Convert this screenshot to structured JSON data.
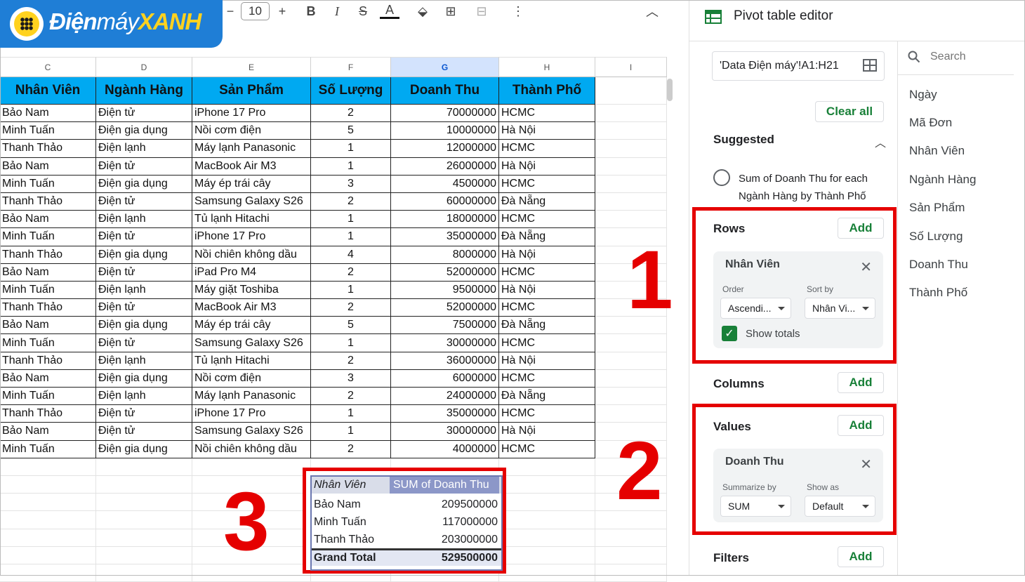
{
  "logo": {
    "text_a": "Điện",
    "text_b": "máy",
    "text_c": "XANH"
  },
  "toolbar": {
    "minus": "−",
    "font_size": "10",
    "plus": "+",
    "bold": "B",
    "italic": "I",
    "strike": "S",
    "textcolor": "A",
    "fill": "⬙",
    "borders": "⊞",
    "merge": "⊟",
    "more": "⋮",
    "collapse": "︿"
  },
  "columns": [
    "C",
    "D",
    "E",
    "F",
    "G",
    "H",
    "I"
  ],
  "table": {
    "headers": [
      "Nhân Viên",
      "Ngành Hàng",
      "Sản Phẩm",
      "Số Lượng",
      "Doanh Thu",
      "Thành Phố"
    ],
    "rows": [
      [
        "Bảo Nam",
        "Điện tử",
        "iPhone 17 Pro",
        "2",
        "70000000",
        "HCMC"
      ],
      [
        "Minh Tuấn",
        "Điện gia dụng",
        "Nồi cơm điện",
        "5",
        "10000000",
        "Hà Nội"
      ],
      [
        "Thanh Thảo",
        "Điện lạnh",
        "Máy lạnh Panasonic",
        "1",
        "12000000",
        "HCMC"
      ],
      [
        "Bảo Nam",
        "Điện tử",
        "MacBook Air M3",
        "1",
        "26000000",
        "Hà Nội"
      ],
      [
        "Minh Tuấn",
        "Điện gia dụng",
        "Máy ép trái cây",
        "3",
        "4500000",
        "HCMC"
      ],
      [
        "Thanh Thảo",
        "Điện tử",
        "Samsung Galaxy S26",
        "2",
        "60000000",
        "Đà Nẵng"
      ],
      [
        "Bảo Nam",
        "Điện lạnh",
        "Tủ lạnh Hitachi",
        "1",
        "18000000",
        "HCMC"
      ],
      [
        "Minh Tuấn",
        "Điện tử",
        "iPhone 17 Pro",
        "1",
        "35000000",
        "Đà Nẵng"
      ],
      [
        "Thanh Thảo",
        "Điện gia dụng",
        "Nồi chiên không dầu",
        "4",
        "8000000",
        "Hà Nội"
      ],
      [
        "Bảo Nam",
        "Điện tử",
        "iPad Pro M4",
        "2",
        "52000000",
        "HCMC"
      ],
      [
        "Minh Tuấn",
        "Điện lạnh",
        "Máy giặt Toshiba",
        "1",
        "9500000",
        "Hà Nội"
      ],
      [
        "Thanh Thảo",
        "Điện tử",
        "MacBook Air M3",
        "2",
        "52000000",
        "HCMC"
      ],
      [
        "Bảo Nam",
        "Điện gia dụng",
        "Máy ép trái cây",
        "5",
        "7500000",
        "Đà Nẵng"
      ],
      [
        "Minh Tuấn",
        "Điện tử",
        "Samsung Galaxy S26",
        "1",
        "30000000",
        "HCMC"
      ],
      [
        "Thanh Thảo",
        "Điện lạnh",
        "Tủ lạnh Hitachi",
        "2",
        "36000000",
        "Hà Nội"
      ],
      [
        "Bảo Nam",
        "Điện gia dụng",
        "Nồi cơm điện",
        "3",
        "6000000",
        "HCMC"
      ],
      [
        "Minh Tuấn",
        "Điện lạnh",
        "Máy lạnh Panasonic",
        "2",
        "24000000",
        "Đà Nẵng"
      ],
      [
        "Thanh Thảo",
        "Điện tử",
        "iPhone 17 Pro",
        "1",
        "35000000",
        "HCMC"
      ],
      [
        "Bảo Nam",
        "Điện tử",
        "Samsung Galaxy S26",
        "1",
        "30000000",
        "Hà Nội"
      ],
      [
        "Minh Tuấn",
        "Điện gia dụng",
        "Nồi chiên không dầu",
        "2",
        "4000000",
        "HCMC"
      ]
    ]
  },
  "pivot": {
    "header_row": "Nhân Viên",
    "header_value": "SUM of Doanh Thu",
    "rows": [
      {
        "name": "Bảo Nam",
        "value": "209500000"
      },
      {
        "name": "Minh Tuấn",
        "value": "117000000"
      },
      {
        "name": "Thanh Thảo",
        "value": "203000000"
      }
    ],
    "total_label": "Grand Total",
    "total_value": "529500000"
  },
  "annotations": {
    "one": "1",
    "two": "2",
    "three": "3"
  },
  "panel": {
    "title": "Pivot table editor",
    "range": "'Data Điện máy'!A1:H21",
    "clear_all": "Clear all",
    "suggested": "Suggested",
    "suggestion_line1": "Sum of Doanh Thu for each",
    "suggestion_line2": "Ngành Hàng by Thành Phố",
    "rows_label": "Rows",
    "columns_label": "Columns",
    "values_label": "Values",
    "filters_label": "Filters",
    "add": "Add",
    "row_card": {
      "title": "Nhân Viên",
      "order_label": "Order",
      "order_value": "Ascendi...",
      "sortby_label": "Sort by",
      "sortby_value": "Nhân Vi...",
      "show_totals": "Show totals"
    },
    "value_card": {
      "title": "Doanh Thu",
      "summarize_label": "Summarize by",
      "summarize_value": "SUM",
      "showas_label": "Show as",
      "showas_value": "Default"
    }
  },
  "fields": {
    "search_placeholder": "Search",
    "items": [
      "Ngày",
      "Mã Đơn",
      "Nhân Viên",
      "Ngành Hàng",
      "Sản Phẩm",
      "Số Lượng",
      "Doanh Thu",
      "Thành Phố"
    ]
  },
  "colors": {
    "header_fill": "#00a9f1",
    "accent_red": "#e50000",
    "add_green": "#188038",
    "logo_blue": "#1f7ed6",
    "logo_yellow": "#ffd21f"
  }
}
